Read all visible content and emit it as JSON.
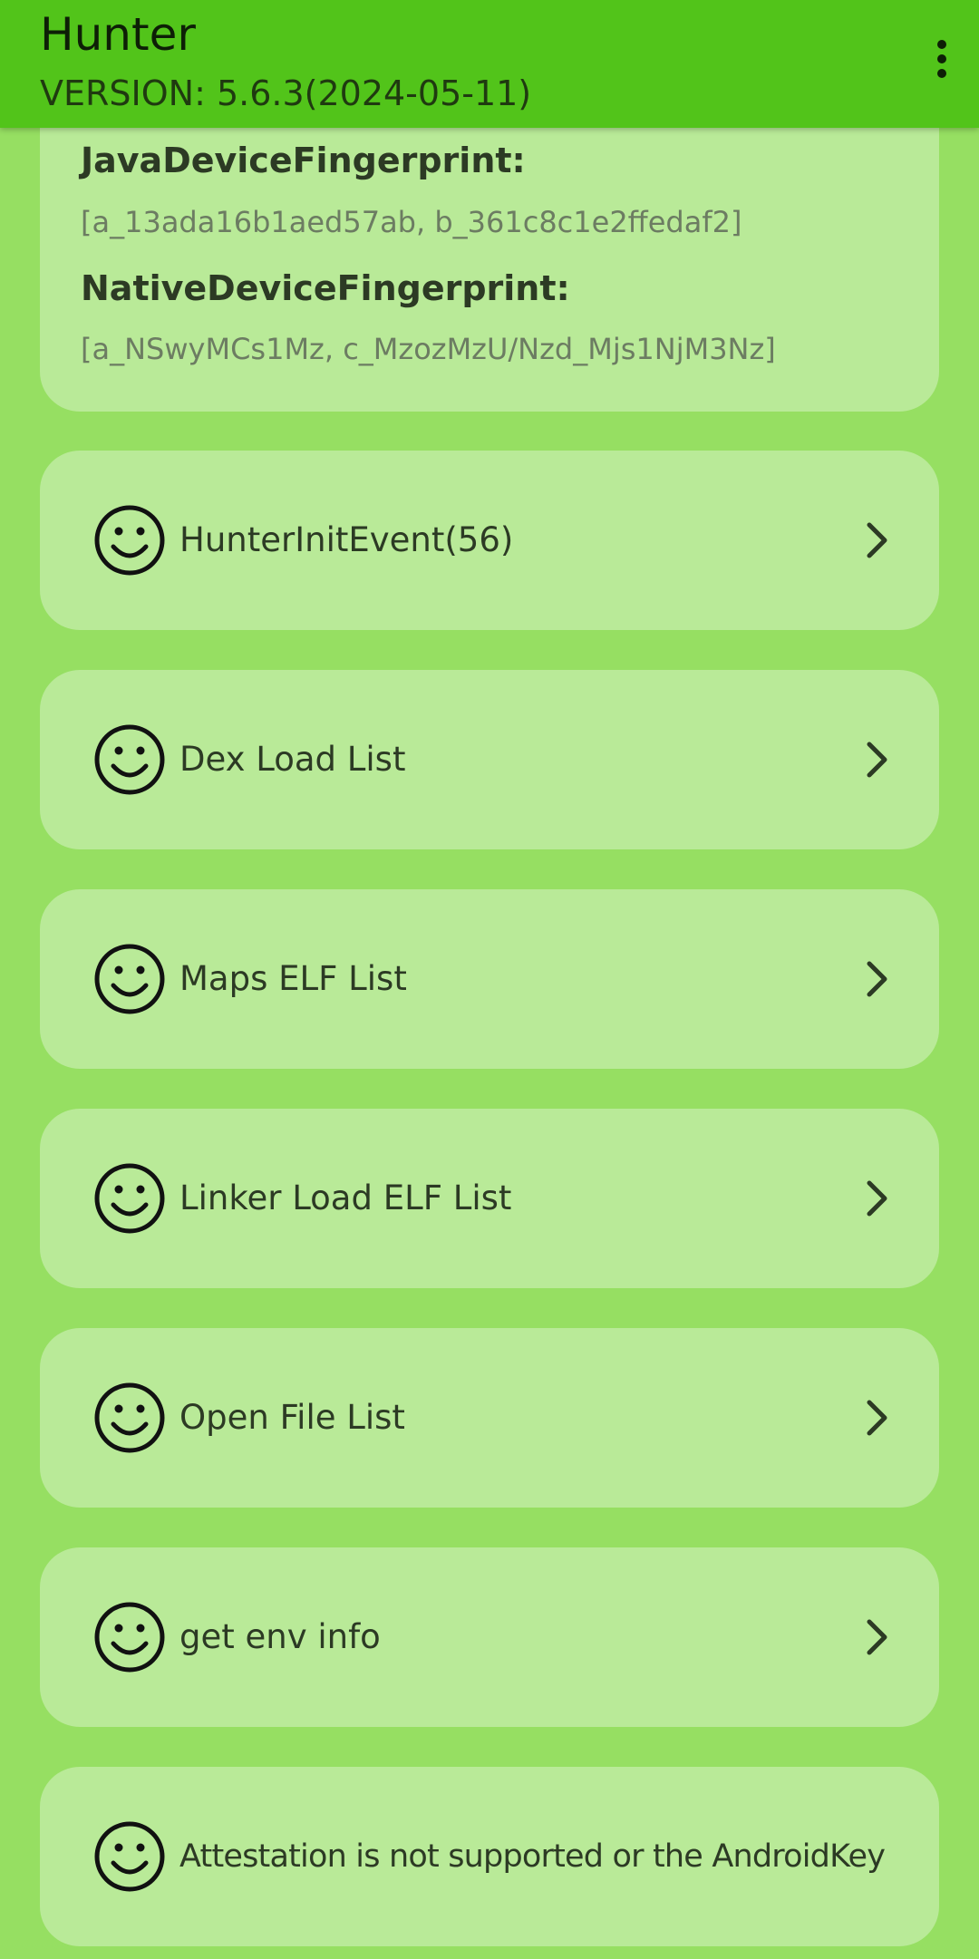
{
  "appbar": {
    "title": "Hunter",
    "version": "VERSION: 5.6.3(2024-05-11)",
    "more_icon": "more-vert-icon",
    "color": "#52c41a"
  },
  "fingerprint": {
    "java_label": "JavaDeviceFingerprint:",
    "java_value": "[a_13ada16b1aed57ab, b_361c8c1e2ffedaf2]",
    "native_label": "NativeDeviceFingerprint:",
    "native_value": "[a_NSwyMCs1Mz, c_MzozMzU/Nzd_Mjs1NjM3Nz]"
  },
  "menu": [
    {
      "label": "HunterInitEvent(56)",
      "icon": "smiley-icon"
    },
    {
      "label": "Dex Load List",
      "icon": "smiley-icon"
    },
    {
      "label": "Maps ELF List",
      "icon": "smiley-icon"
    },
    {
      "label": "Linker Load ELF List",
      "icon": "smiley-icon"
    },
    {
      "label": "Open File List",
      "icon": "smiley-icon"
    },
    {
      "label": "get env info",
      "icon": "smiley-icon"
    },
    {
      "label": "Attestation is not supported or the AndroidKey",
      "icon": "smiley-icon"
    }
  ],
  "colors": {
    "background": "#96df62",
    "card": "#b9ea98",
    "text": "#2c3a24"
  }
}
